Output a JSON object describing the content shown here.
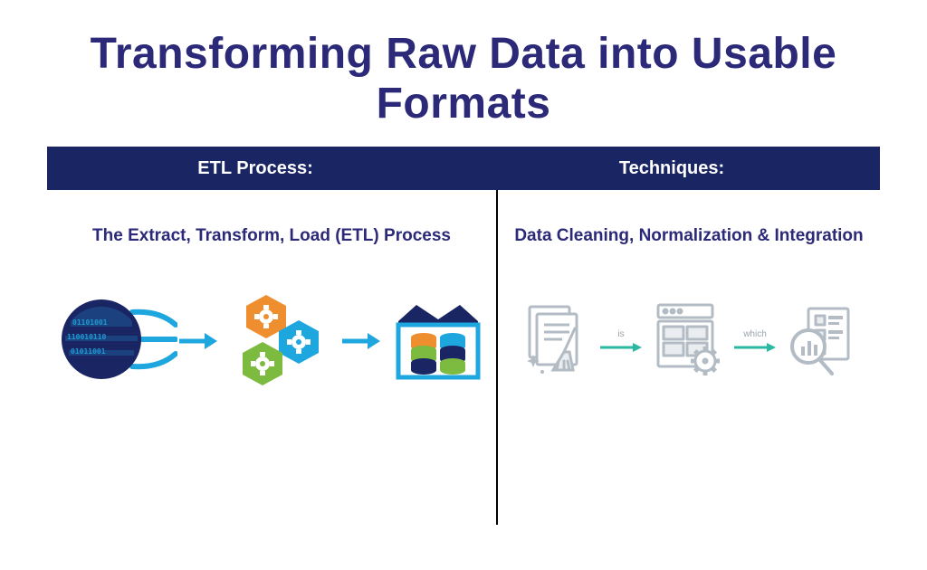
{
  "title": "Transforming Raw Data into Usable Formats",
  "header": {
    "left": "ETL Process:",
    "right": "Techniques:"
  },
  "left_panel": {
    "subhead": "The Extract, Transform, Load (ETL) Process",
    "icons": {
      "extract": "binary-data-globe-icon",
      "transform": "gears-hexagon-icon",
      "load": "data-warehouse-icon"
    }
  },
  "right_panel": {
    "subhead": "Data Cleaning, Normalization & Integration",
    "icons": {
      "cleaning": "broom-document-icon",
      "normalization": "structured-form-gear-icon",
      "integration": "magnifier-chart-icon"
    },
    "connector_labels": {
      "first": "is",
      "second": "which"
    }
  },
  "colors": {
    "header_bg": "#1a2563",
    "accent": "#2b2978",
    "icon_blue": "#1ea6de",
    "icon_teal": "#2bb8a3",
    "icon_green": "#7cbb3f",
    "icon_orange": "#ef8e2f",
    "icon_gray": "#b3bcc4"
  }
}
